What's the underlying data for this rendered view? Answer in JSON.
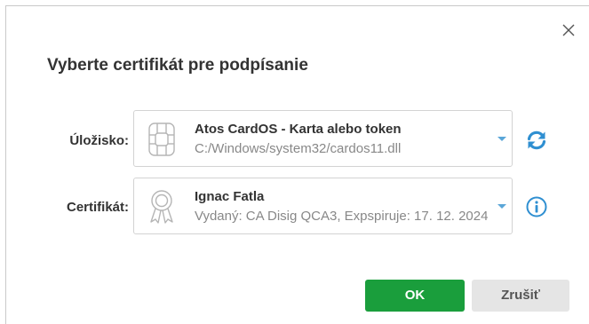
{
  "dialog": {
    "title": "Vyberte certifikát pre podpísanie",
    "close_icon": "close-icon"
  },
  "storage": {
    "label": "Úložisko:",
    "name": "Atos CardOS - Karta alebo token",
    "path": "C:/Windows/system32/cardos11.dll",
    "icon": "smart-card-chip-icon",
    "action_icon": "refresh-icon"
  },
  "certificate": {
    "label": "Certifikát:",
    "name": "Ignac Fatla",
    "details": "Vydaný: CA Disig QCA3, Expspiruje: 17. 12. 2024",
    "icon": "certificate-badge-icon",
    "action_icon": "info-icon"
  },
  "buttons": {
    "ok": "OK",
    "cancel": "Zrušiť"
  },
  "colors": {
    "ok_button": "#1a9e3c",
    "accent_blue": "#2f8fd1",
    "caret_blue": "#5aa6d8"
  }
}
